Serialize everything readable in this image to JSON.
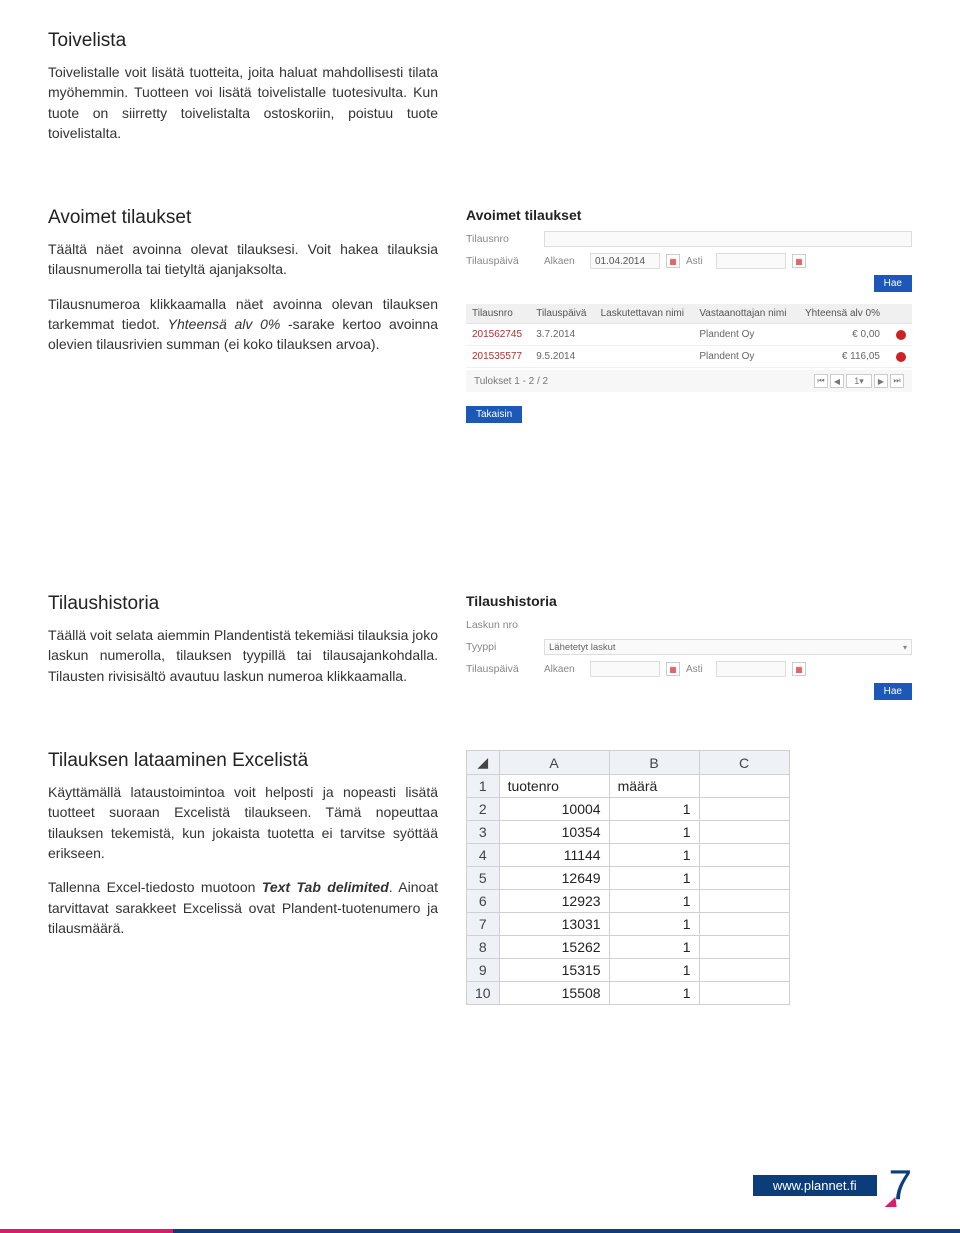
{
  "toivelista": {
    "heading": "Toivelista",
    "para": "Toivelistalle voit lisätä tuotteita, joita haluat mahdollisesti tilata myöhemmin. Tuotteen voi lisätä toivelistalle tuotesivulta. Kun tuote on siirretty toivelistalta ostoskoriin, poistuu tuote toivelistalta."
  },
  "avoimet": {
    "heading": "Avoimet tilaukset",
    "para1": "Täältä näet avoinna olevat tilauksesi. Voit hakea tilauksia tilausnumerolla tai tietyltä ajanjaksolta.",
    "para2a": "Tilausnumeroa klikkaamalla näet avoinna olevan tilauksen tarkemmat tiedot. ",
    "para2b": "Yhteensä alv 0%",
    "para2c": " -sarake kertoo avoinna olevien tilausrivien summan (ei koko tilauksen arvoa).",
    "panel": {
      "title": "Avoimet tilaukset",
      "label_tilausnro": "Tilausnro",
      "label_tilauspaiva": "Tilauspäivä",
      "label_alkaen": "Alkaen",
      "alkaen_value": "01.04.2014",
      "label_asti": "Asti",
      "btn_hae": "Hae",
      "cols": [
        "Tilausnro",
        "Tilauspäivä",
        "Laskutettavan nimi",
        "Vastaanottajan nimi",
        "Yhteensä alv 0%"
      ],
      "rows": [
        {
          "nro": "201562745",
          "pvm": "3.7.2014",
          "lask": "",
          "vast": "Plandent Oy",
          "sum": "€ 0,00"
        },
        {
          "nro": "201535577",
          "pvm": "9.5.2014",
          "lask": "",
          "vast": "Plandent Oy",
          "sum": "€ 116,05"
        }
      ],
      "results_label": "Tulokset 1 - 2 / 2",
      "page_current": "1",
      "btn_back": "Takaisin"
    }
  },
  "historia": {
    "heading": "Tilaushistoria",
    "para": "Täällä voit selata aiemmin Plandentistä tekemiäsi tilauksia joko laskun numerolla, tilauksen tyypillä tai tilausajankohdalla. Tilausten rivisisältö avautuu laskun numeroa klikkaamalla.",
    "panel": {
      "title": "Tilaushistoria",
      "label_laskunro": "Laskun nro",
      "label_tyyppi": "Tyyppi",
      "tyyppi_value": "Lähetetyt laskut",
      "label_tilauspaiva": "Tilauspäivä",
      "label_alkaen": "Alkaen",
      "label_asti": "Asti",
      "btn_hae": "Hae"
    }
  },
  "excel": {
    "heading": "Tilauksen lataaminen Excelistä",
    "para1": "Käyttämällä lataustoimintoa voit helposti ja nopeasti lisätä tuotteet suoraan Excelistä tilaukseen. Tämä nopeuttaa tilauksen tekemistä, kun jokaista tuotetta ei tarvitse syöttää erikseen.",
    "para2a": "Tallenna Excel-tiedosto muotoon ",
    "para2b": "Text Tab delimited",
    "para2c": ". Ainoat tarvittavat sarakkeet Excelissä ovat Plandent-tuotenumero ja tilausmäärä.",
    "table": {
      "cols": [
        "A",
        "B",
        "C"
      ],
      "header_row": [
        "tuotenro",
        "määrä",
        ""
      ],
      "rows": [
        [
          "10004",
          "1",
          ""
        ],
        [
          "10354",
          "1",
          ""
        ],
        [
          "11144",
          "1",
          ""
        ],
        [
          "12649",
          "1",
          ""
        ],
        [
          "12923",
          "1",
          ""
        ],
        [
          "13031",
          "1",
          ""
        ],
        [
          "15262",
          "1",
          ""
        ],
        [
          "15315",
          "1",
          ""
        ],
        [
          "15508",
          "1",
          ""
        ]
      ]
    }
  },
  "footer": {
    "url": "www.plannet.fi",
    "page": "7"
  }
}
